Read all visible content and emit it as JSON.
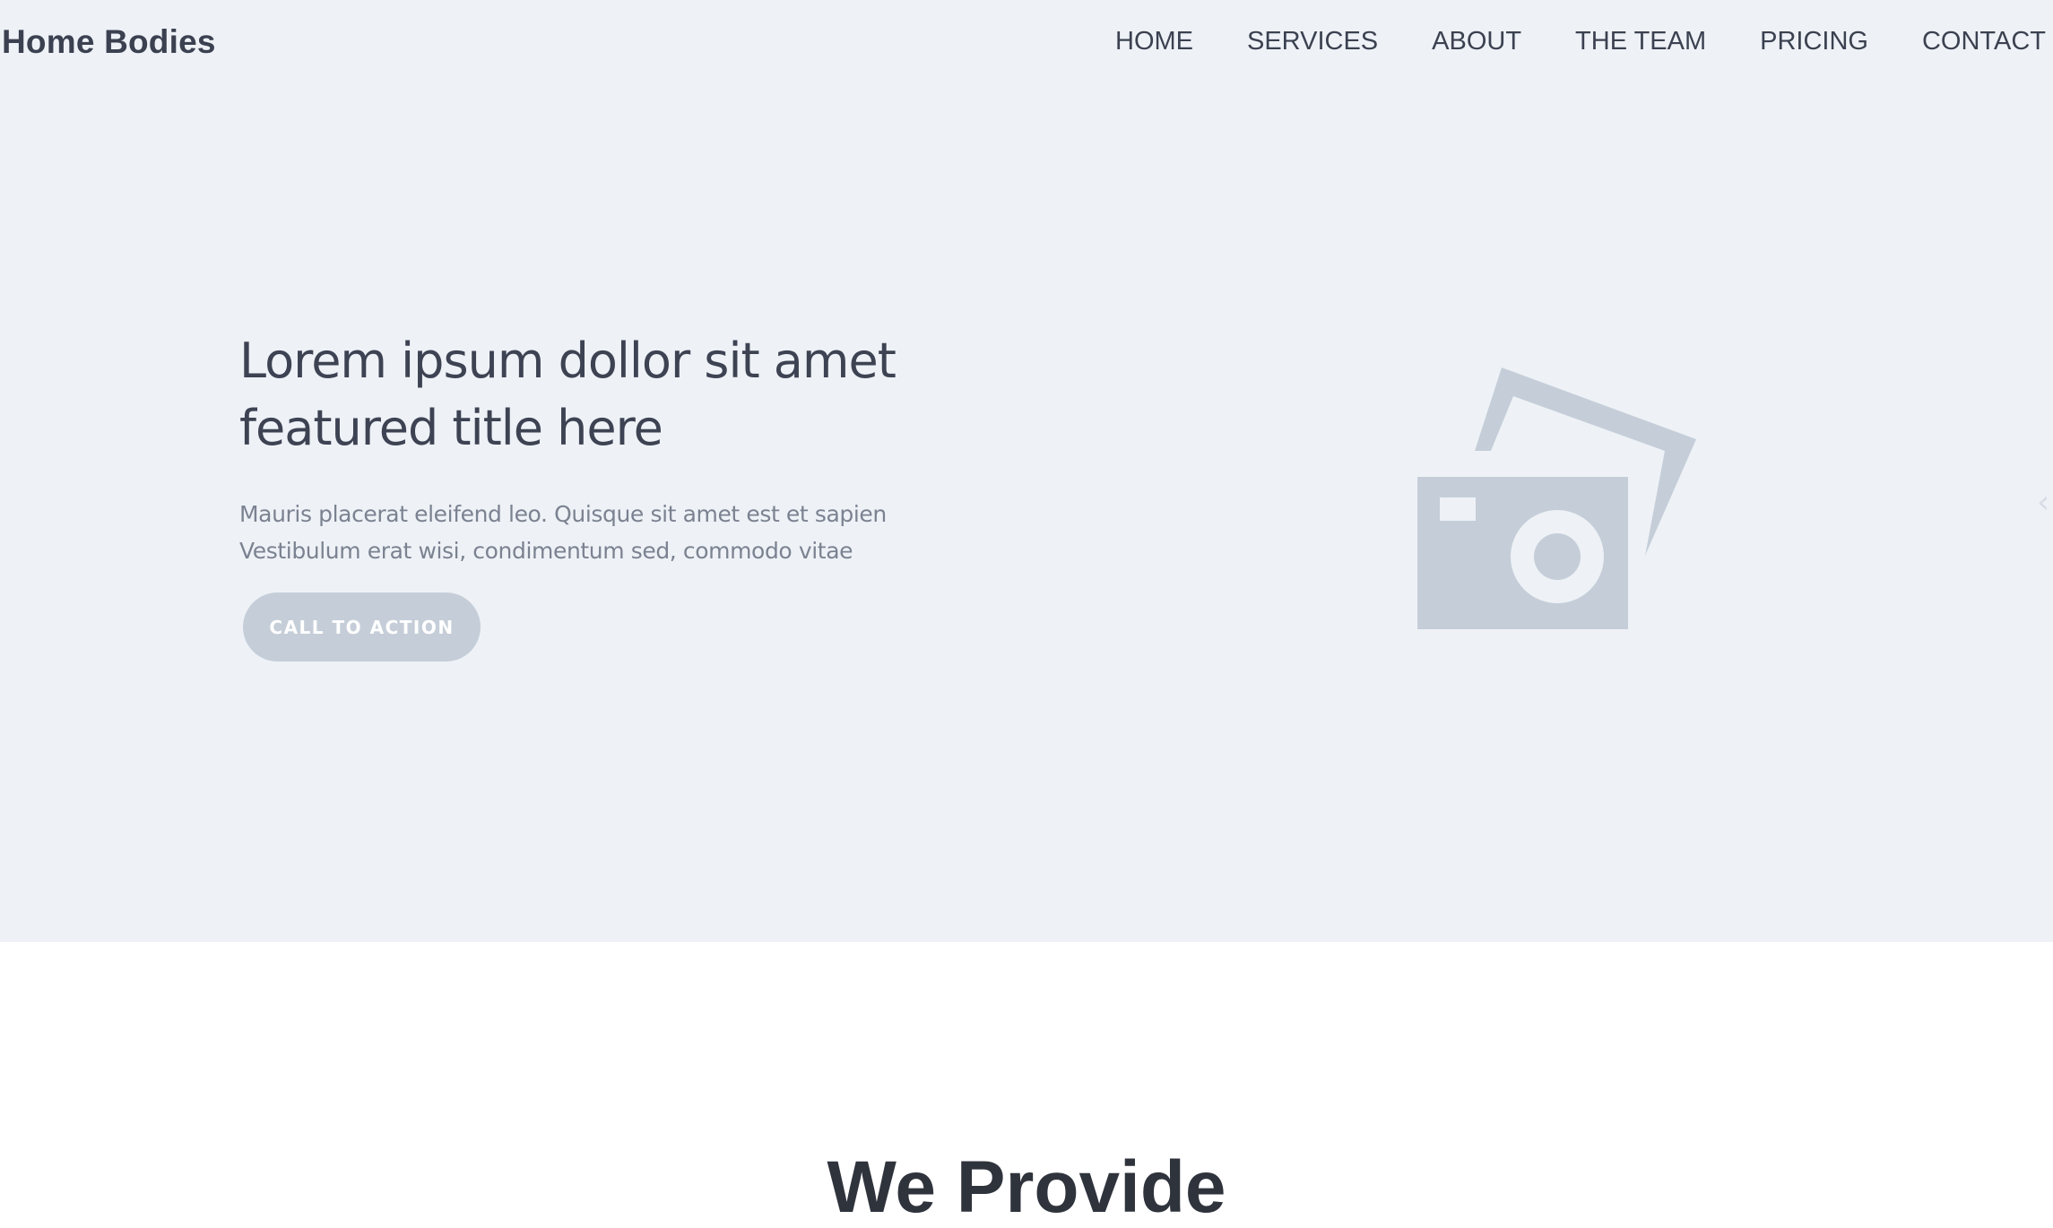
{
  "brand": {
    "name": "Home Bodies"
  },
  "nav": {
    "items": [
      {
        "label": "HOME"
      },
      {
        "label": "SERVICES"
      },
      {
        "label": "ABOUT"
      },
      {
        "label": "THE TEAM"
      },
      {
        "label": "PRICING"
      },
      {
        "label": "CONTACT"
      }
    ]
  },
  "hero": {
    "title_line1": "Lorem ipsum dollor sit amet",
    "title_line2": "featured title here",
    "subtitle_line1": "Mauris placerat eleifend leo. Quisque sit amet est et sapien",
    "subtitle_line2": "Vestibulum erat wisi, condimentum sed, commodo vitae",
    "cta_label": "CALL TO ACTION",
    "image_icon": "photo-placeholder-icon",
    "arrow_glyph": "‹"
  },
  "section": {
    "heading": "We Provide"
  },
  "colors": {
    "hero_background": "#eef2f7",
    "text_dark": "#3e4353",
    "text_muted": "#7b8290",
    "button_bg": "#c5ced8",
    "placeholder_icon": "#c5ced8"
  }
}
